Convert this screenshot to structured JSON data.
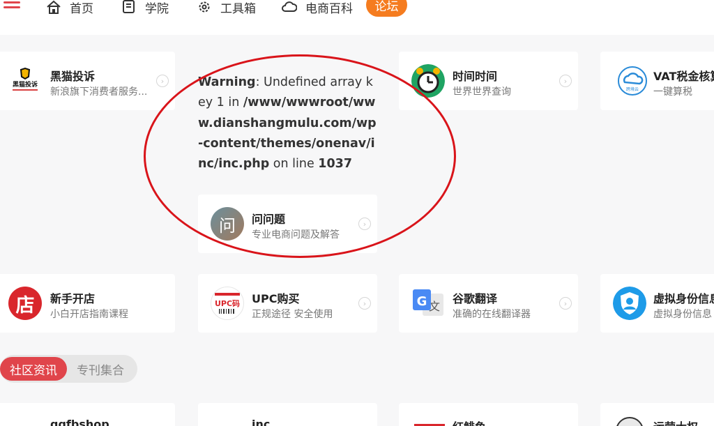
{
  "nav": {
    "items": [
      {
        "label": "首页",
        "icon": "home-icon"
      },
      {
        "label": "学院",
        "icon": "book-icon"
      },
      {
        "label": "工具箱",
        "icon": "gear-icon"
      },
      {
        "label": "电商百科",
        "icon": "cloud-icon"
      }
    ],
    "forum_label": "论坛",
    "accent": "#e0454b",
    "forum_color": "#f57c1f"
  },
  "warning": {
    "label": "Warning",
    "text1": ": Undefined array key 1 in ",
    "path": "/www/wwwroot/www.dianshangmulu.com/wp-content/themes/onenav/inc/inc.php",
    "text2": " on line ",
    "line": "1037"
  },
  "cards": {
    "heimao": {
      "title": "黑猫投诉",
      "desc": "新浪旗下消费者服务...",
      "logo_text": "黑猫投诉"
    },
    "time": {
      "title": "时间时间",
      "desc": "世界世界查询"
    },
    "vat": {
      "title": "VAT税金核算",
      "desc": "一键算税",
      "logo_text": "跨境云"
    },
    "wenti": {
      "title": "问问题",
      "desc": "专业电商问题及解答",
      "logo_text": "问"
    },
    "xinshou": {
      "title": "新手开店",
      "desc": "小白开店指南课程",
      "logo_text": "店"
    },
    "upc": {
      "title": "UPC购买",
      "desc": "正规途径 安全使用",
      "logo_text": "UPC码"
    },
    "google": {
      "title": "谷歌翻译",
      "desc": "准确的在线翻译器"
    },
    "virtual": {
      "title": "虚拟身份信息",
      "desc": "虚拟身份信息"
    }
  },
  "tabs": {
    "active": "社区资讯",
    "other": "专刊集合"
  },
  "bottom": {
    "c1": "gqfbshop",
    "c2": "inc",
    "c3": "红鲱鱼",
    "c4": "运营大权"
  }
}
